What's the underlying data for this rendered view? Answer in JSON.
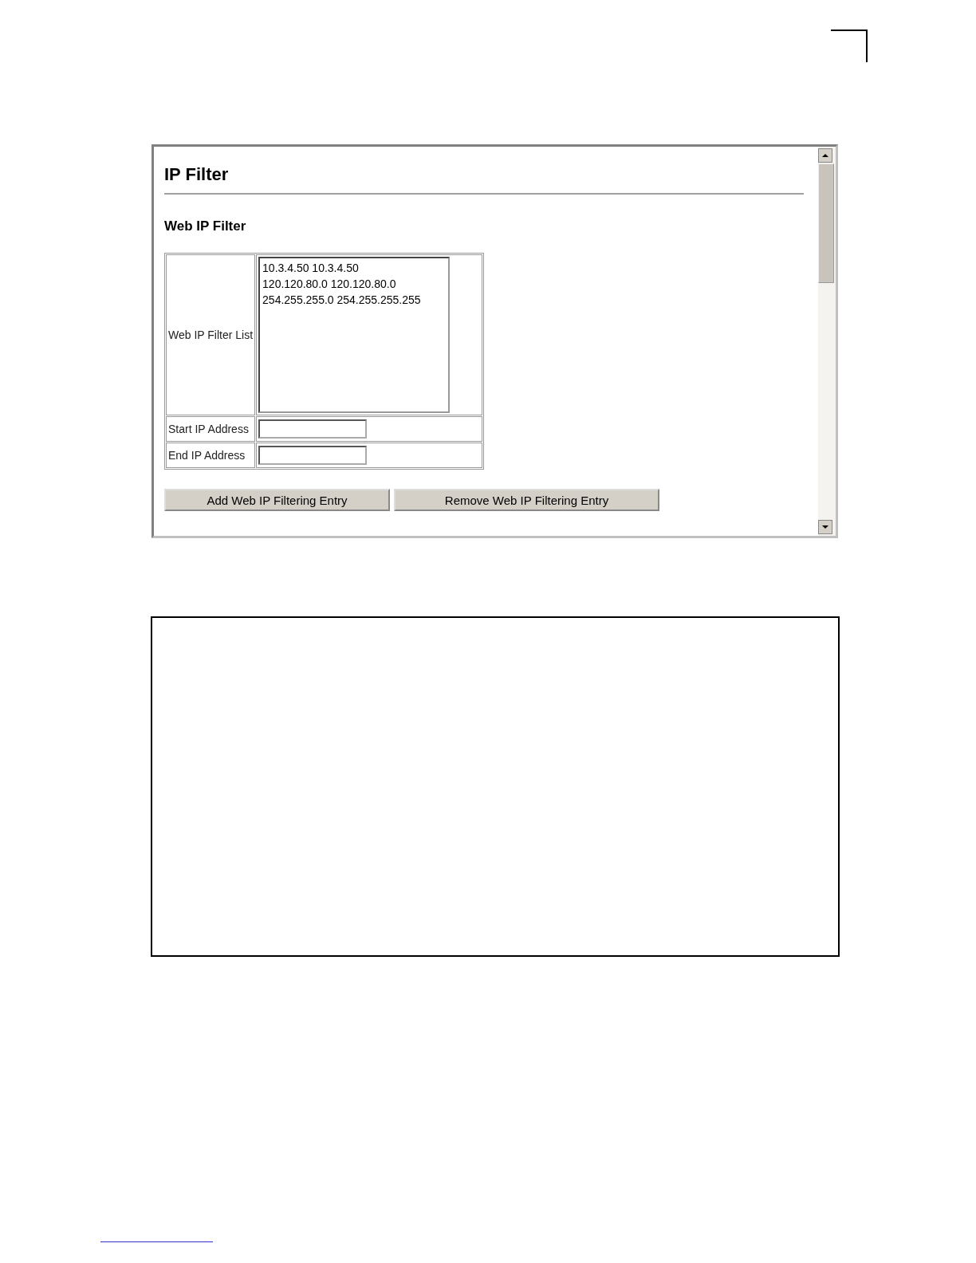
{
  "page": {
    "title": "IP Filter",
    "section": "Web IP Filter",
    "form": {
      "list_label": "Web IP Filter List",
      "list_entries": [
        "10.3.4.50 10.3.4.50",
        "120.120.80.0 120.120.80.0",
        "254.255.255.0 254.255.255.255"
      ],
      "start_label": "Start IP Address",
      "end_label": "End IP Address"
    },
    "buttons": [
      "Add Web IP Filtering Entry",
      "Remove Web IP Filtering Entry"
    ]
  }
}
